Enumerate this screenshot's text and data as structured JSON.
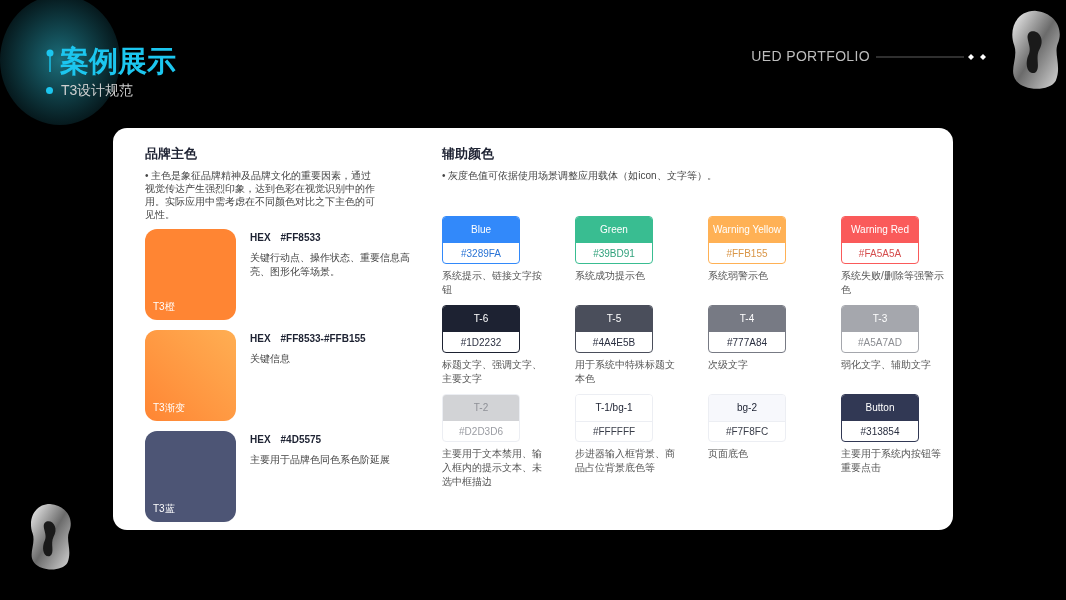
{
  "header": {
    "title": "案例展示",
    "subtitle": "T3设计规范",
    "brand": "UED PORTFOLIO"
  },
  "brand_colors": {
    "title": "品牌主色",
    "note": "• 主色是象征品牌精神及品牌文化的重要因素，通过视觉传达产生强烈印象，达到色彩在视觉识别中的作用。实际应用中需考虑在不同颜色对比之下主色的可见性。",
    "items": [
      {
        "name": "T3橙",
        "hex_label": "HEX",
        "hex": "#FF8533",
        "desc": "关键行动点、操作状态、重要信息高亮、图形化等场景。",
        "kind": "solid",
        "color": "#ff8533"
      },
      {
        "name": "T3渐变",
        "hex_label": "HEX",
        "hex": "#FF8533-#FFB155",
        "desc": "关键信息",
        "kind": "gradient",
        "color": "#ff8533"
      },
      {
        "name": "T3蓝",
        "hex_label": "HEX",
        "hex": "#4D5575",
        "desc": "主要用于品牌色同色系色阶延展",
        "kind": "solid",
        "color": "#4d5575"
      }
    ]
  },
  "aux_colors": {
    "title": "辅助颜色",
    "note": "• 灰度色值可依据使用场景调整应用载体（如icon、文字等）。",
    "items": [
      {
        "name": "Blue",
        "hex": "#3289FA",
        "desc": "系统提示、链接文字按钮",
        "kind": "accent",
        "color": "#3289fa"
      },
      {
        "name": "Green",
        "hex": "#39BD91",
        "desc": "系统成功提示色",
        "kind": "accent",
        "color": "#39bd91"
      },
      {
        "name": "Warning Yellow",
        "hex": "#FFB155",
        "desc": "系统弱警示色",
        "kind": "accent",
        "color": "#ffb155"
      },
      {
        "name": "Warning Red",
        "hex": "#FA5A5A",
        "desc": "系统失败/删除等强警示色",
        "kind": "accent",
        "color": "#fa5a5a"
      },
      {
        "name": "T-6",
        "hex": "#1D2232",
        "desc": "标题文字、强调文字、主要文字",
        "kind": "neutral",
        "color": "#1d2232"
      },
      {
        "name": "T-5",
        "hex": "#4A4E5B",
        "desc": "用于系统中特殊标题文本色",
        "kind": "neutral",
        "color": "#4a4e5b"
      },
      {
        "name": "T-4",
        "hex": "#777A84",
        "desc": "次级文字",
        "kind": "neutral",
        "color": "#777a84"
      },
      {
        "name": "T-3",
        "hex": "#A5A7AD",
        "desc": "弱化文字、辅助文字",
        "kind": "accent",
        "color": "#a5a7ad"
      },
      {
        "name": "T-2",
        "hex": "#D2D3D6",
        "desc": "主要用于文本禁用、输入框内的提示文本、未选中框描边",
        "kind": "muted",
        "color": "#d2d3d6"
      },
      {
        "name": "T-1/bg-1",
        "hex": "#FFFFFF",
        "desc": "步进器输入框背景、商品占位背景底色等",
        "kind": "light",
        "color": "#ffffff"
      },
      {
        "name": "bg-2",
        "hex": "#F7F8FC",
        "desc": "页面底色",
        "kind": "light",
        "color": "#f7f8fc"
      },
      {
        "name": "Button",
        "hex": "#313854",
        "desc": "主要用于系统内按钮等重要点击",
        "kind": "neutral",
        "color": "#313854"
      }
    ]
  }
}
